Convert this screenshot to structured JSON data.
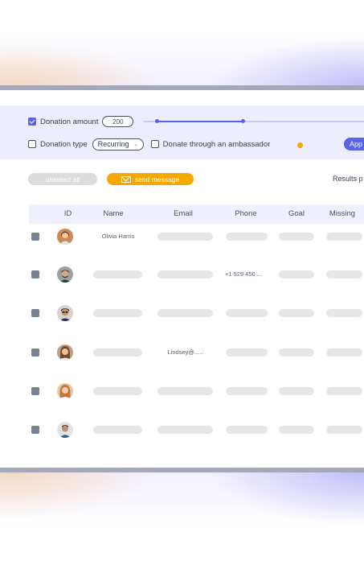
{
  "filters": {
    "donation_amount_label": "Donation amount",
    "donation_amount_checked": true,
    "donation_amount_value": "200",
    "donation_type_label": "Donation type",
    "donation_type_checked": false,
    "donation_type_value": "Recurring",
    "ambassador_label": "Donate through an ambassador",
    "ambassador_checked": false,
    "apply_label": "App"
  },
  "actions": {
    "unselect_all_label": "unselect all",
    "send_message_label": "send message",
    "results_label": "Results p"
  },
  "table": {
    "columns": [
      "ID",
      "Name",
      "Email",
      "Phone",
      "Goal",
      "Missing"
    ],
    "rows": [
      {
        "name": "Olivia Harris",
        "email": "",
        "phone": ""
      },
      {
        "name": "",
        "email": "",
        "phone": "+1 929 456 ..."
      },
      {
        "name": "",
        "email": "",
        "phone": ""
      },
      {
        "name": "",
        "email": "Lindsey@.....",
        "phone": ""
      },
      {
        "name": "",
        "email": "",
        "phone": ""
      },
      {
        "name": "",
        "email": "",
        "phone": ""
      }
    ]
  },
  "colors": {
    "accent": "#5a62e6",
    "warning": "#f5a800",
    "filter_bg": "#eceefe",
    "skeleton": "#e6e6e6"
  },
  "icons": {
    "send_message": "envelope-icon",
    "select_chevron": "chevron-down-icon"
  }
}
